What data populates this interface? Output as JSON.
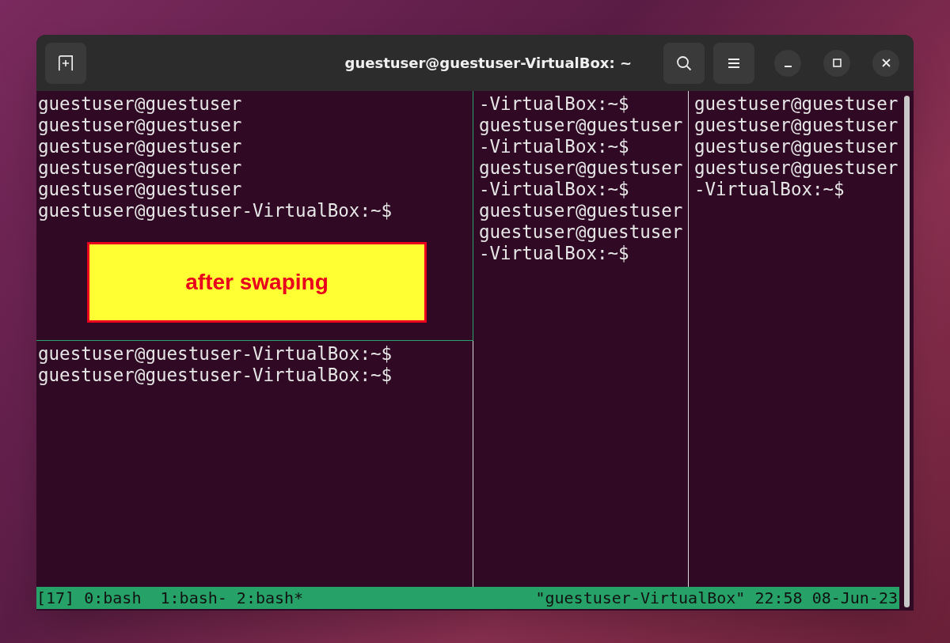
{
  "window": {
    "title": "guestuser@guestuser-VirtualBox: ~"
  },
  "columns": [
    {
      "panes": [
        {
          "active": true,
          "lines": [
            "guestuser@guestuser",
            "guestuser@guestuser",
            "guestuser@guestuser",
            "guestuser@guestuser",
            "guestuser@guestuser",
            "guestuser@guestuser-VirtualBox:~$"
          ],
          "annotation": "after swaping"
        },
        {
          "active": false,
          "lines": [
            "guestuser@guestuser-VirtualBox:~$",
            "guestuser@guestuser-VirtualBox:~$"
          ]
        }
      ]
    },
    {
      "panes": [
        {
          "active": false,
          "lines": [
            "-VirtualBox:~$",
            "guestuser@guestuser",
            "-VirtualBox:~$",
            "guestuser@guestuser",
            "-VirtualBox:~$",
            "guestuser@guestuser",
            "guestuser@guestuser",
            "-VirtualBox:~$"
          ]
        }
      ]
    },
    {
      "panes": [
        {
          "active": false,
          "lines": [
            "guestuser@guestuser",
            "guestuser@guestuser",
            "guestuser@guestuser",
            "guestuser@guestuser",
            "-VirtualBox:~$"
          ]
        }
      ]
    }
  ],
  "status_bar": {
    "left": "[17] 0:bash  1:bash- 2:bash*",
    "right": "\"guestuser-VirtualBox\" 22:58 08-Jun-23"
  }
}
